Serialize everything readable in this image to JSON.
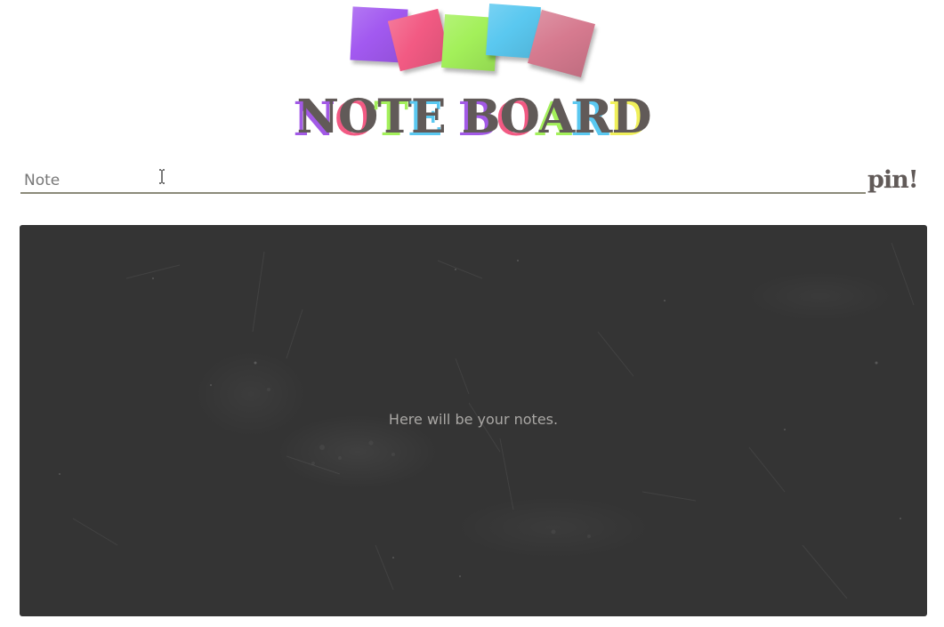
{
  "logo": {
    "title_letters": [
      "N",
      "O",
      "T",
      "E",
      " ",
      "B",
      "O",
      "A",
      "R",
      "D"
    ],
    "shadow_colors": [
      "#a259e6",
      "#f25a83",
      "#a3f05a",
      "#5ac8f0",
      "",
      "#a259e6",
      "#f25a83",
      "#a3f05a",
      "#5ac8f0",
      "#f0f05a"
    ],
    "letter_color": "#615a58",
    "sticky_colors": [
      "#a259f0",
      "#f25a83",
      "#a3f05a",
      "#5ac8f0",
      "#d67a8f"
    ]
  },
  "note_input": {
    "placeholder": "Note",
    "value": ""
  },
  "pin_button": {
    "label": "pin!"
  },
  "board": {
    "placeholder": "Here will be your notes.",
    "background": "#343434"
  },
  "icons": {
    "cursor": "text-cursor-icon"
  }
}
